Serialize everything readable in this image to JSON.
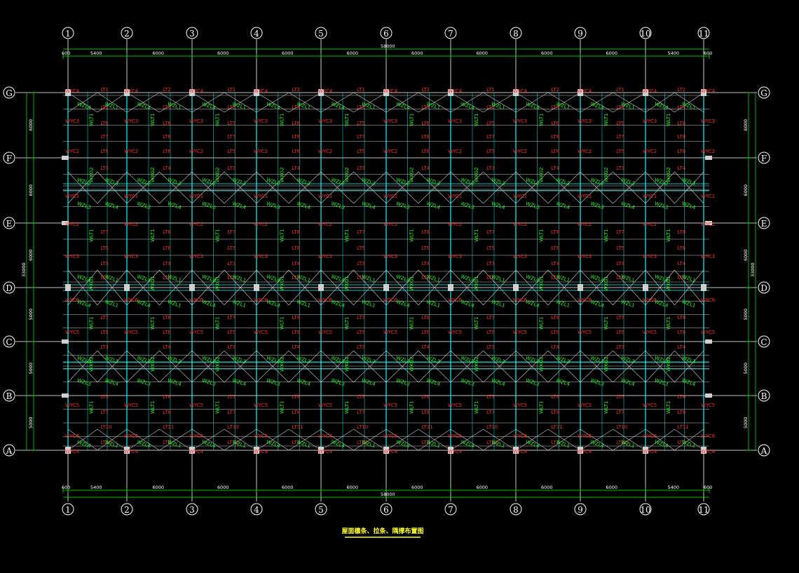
{
  "colors": {
    "background": "#000000",
    "axis_line": "#ffffff",
    "column_line": "#00ffff",
    "purlin_line": "#c8c8c8",
    "brace": "#c8c8c8",
    "tie_red": "#ff2a2a",
    "brace_green": "#22ff22",
    "dimension": "#00ff00",
    "caption": "#ffff33"
  },
  "axes": {
    "columns": [
      "1",
      "2",
      "3",
      "4",
      "5",
      "6",
      "7",
      "8",
      "9",
      "10",
      "11"
    ],
    "rows": [
      "G",
      "F",
      "E",
      "D",
      "C",
      "B",
      "A"
    ]
  },
  "dimensions": {
    "top": [
      "600",
      "5400",
      "6000",
      "6000",
      "6000",
      "6000",
      "6000",
      "6000",
      "6000",
      "6000",
      "5400",
      "600"
    ],
    "top_total": "58000",
    "bottom": [
      "600",
      "5400",
      "6000",
      "6000",
      "6000",
      "6000",
      "6000",
      "6000",
      "6000",
      "6000",
      "5400",
      "600"
    ],
    "bottom_total": "58000",
    "side_left": [
      "6000",
      "6000",
      "6000",
      "5000",
      "5000",
      "5000"
    ],
    "side_right": [
      "6000",
      "6000",
      "6000",
      "5000",
      "5000",
      "5000"
    ],
    "side_total": "33000"
  },
  "member_labels": {
    "wyc": [
      "WYC4",
      "WYC3",
      "WYC2",
      "WYC1",
      "WYC5",
      "WYC6"
    ],
    "lt": [
      "LT1",
      "LT2",
      "LT3",
      "LT4",
      "LT5",
      "LT6",
      "LT7",
      "LT8",
      "LT9",
      "LT10",
      "LT11",
      "LT12"
    ],
    "wlt": [
      "WLT1",
      "WLT2"
    ],
    "wxg": [
      "WXG1",
      "WXG2"
    ],
    "wzl": [
      "WZL1",
      "WZL2",
      "WZL3",
      "WZL4"
    ]
  },
  "caption": "屋面檩条、拉条、隅撑布置图"
}
